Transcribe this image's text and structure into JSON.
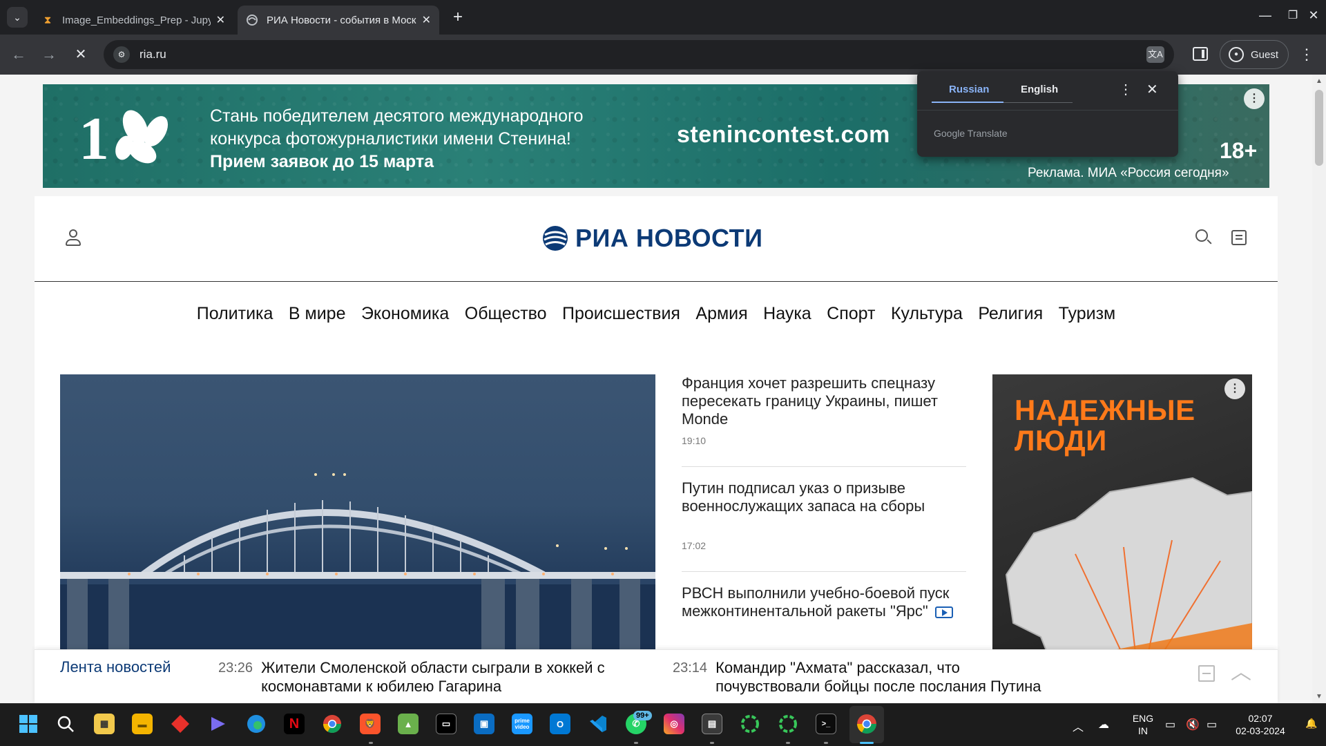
{
  "browser": {
    "tabs": [
      {
        "title": "Image_Embeddings_Prep - Jupyter",
        "active": false
      },
      {
        "title": "РИА Новости - события в Москве",
        "active": true
      }
    ],
    "url": "ria.ru",
    "profile_label": "Guest"
  },
  "translate_popup": {
    "source_language": "Russian",
    "target_language": "English",
    "brand": "Google Translate"
  },
  "banner_ad": {
    "line1": "Стань победителем десятого международного",
    "line2": "конкурса фотожурналистики имени Стенина!",
    "line3": "Прием заявок до 15 марта",
    "site": "stenincontest.com",
    "age_rating": "18+",
    "disclaimer": "Реклама. МИА «Россия сегодня»"
  },
  "site": {
    "logo_text": "РИА НОВОСТИ",
    "nav": [
      "Политика",
      "В мире",
      "Экономика",
      "Общество",
      "Происшествия",
      "Армия",
      "Наука",
      "Спорт",
      "Культура",
      "Религия",
      "Туризм"
    ],
    "news": [
      {
        "title": "Франция хочет разрешить спецназу пересекать границу Украины, пишет Monde",
        "time": "19:10"
      },
      {
        "title": "Путин подписал указ о призыве военнослужащих запаса на сборы",
        "time": "17:02"
      },
      {
        "title": "РВСН выполнили учебно-боевой пуск межконтинентальной ракеты \"Ярс\"",
        "time": ""
      }
    ],
    "side_ad_title": "НАДЕЖНЫЕ ЛЮДИ"
  },
  "ticker": {
    "label": "Лента новостей",
    "items": [
      {
        "time": "23:26",
        "text": "Жители Смоленской области сыграли в хоккей с космонавтами к юбилею Гагарина"
      },
      {
        "time": "23:14",
        "text": "Командир \"Ахмата\" рассказал, что почувствовали бойцы после послания Путина"
      }
    ]
  },
  "taskbar": {
    "whatsapp_badge": "99+",
    "language_line1": "ENG",
    "language_line2": "IN",
    "time": "02:07",
    "date": "02-03-2024"
  },
  "colors": {
    "brand_blue": "#0c3a76",
    "banner_teal": "#2a8077",
    "translate_accent": "#8ab4f8",
    "side_ad_orange": "#ff7a1a"
  }
}
